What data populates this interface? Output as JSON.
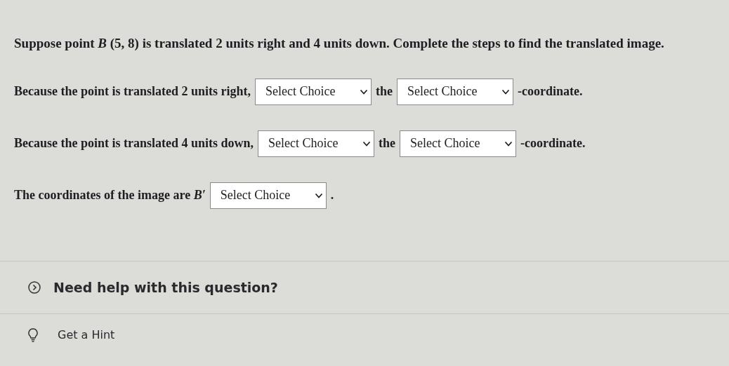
{
  "question": "Suppose point *B* (5, 8) is translated 2 units right and 4 units down. Complete the steps to find the translated image.",
  "steps": [
    {
      "parts": [
        {
          "kind": "text",
          "text": "Because the point is translated 2 units right,"
        },
        {
          "kind": "dropdown",
          "value": "Select Choice"
        },
        {
          "kind": "text",
          "text": "the"
        },
        {
          "kind": "dropdown",
          "value": "Select Choice"
        },
        {
          "kind": "text",
          "text": "-coordinate."
        }
      ]
    },
    {
      "parts": [
        {
          "kind": "text",
          "text": "Because the point is translated 4 units down,"
        },
        {
          "kind": "dropdown",
          "value": "Select Choice"
        },
        {
          "kind": "text",
          "text": "the"
        },
        {
          "kind": "dropdown",
          "value": "Select Choice"
        },
        {
          "kind": "text",
          "text": "-coordinate."
        }
      ]
    },
    {
      "parts": [
        {
          "kind": "text",
          "text": "The coordinates of the image are *B′*"
        },
        {
          "kind": "dropdown",
          "value": "Select Choice"
        },
        {
          "kind": "text",
          "text": "."
        }
      ]
    }
  ],
  "help": {
    "label": "Need help with this question?",
    "expanded": false
  },
  "hint": {
    "label": "Get a Hint"
  }
}
